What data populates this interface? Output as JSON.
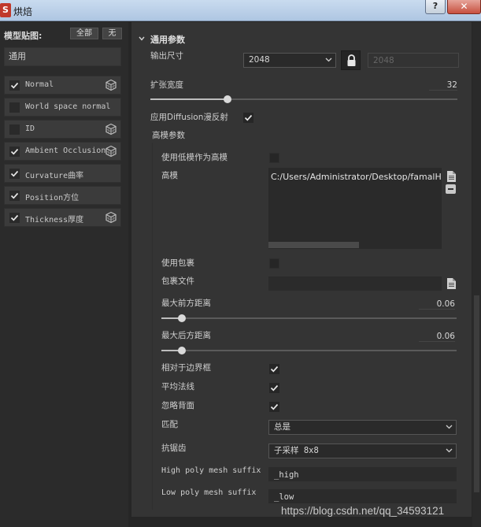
{
  "window": {
    "title": "烘焙",
    "app_icon_letter": "S",
    "help_label": "?",
    "close_label": "✕"
  },
  "left_panel": {
    "header": "模型贴图:",
    "all_label": "全部",
    "none_label": "无",
    "mode_selected": "通用",
    "maps": [
      {
        "label": "Normal",
        "checked": true,
        "has_icon": true
      },
      {
        "label": "World space normal",
        "checked": false,
        "has_icon": false
      },
      {
        "label": "ID",
        "checked": false,
        "has_icon": true
      },
      {
        "label": "Ambient Occlusion",
        "checked": true,
        "has_icon": true
      },
      {
        "label": "Curvature曲率",
        "checked": true,
        "has_icon": false
      },
      {
        "label": "Position方位",
        "checked": true,
        "has_icon": false
      },
      {
        "label": "Thickness厚度",
        "checked": true,
        "has_icon": true
      }
    ]
  },
  "common_params": {
    "section_title": "通用参数",
    "output_size_label": "输出尺寸",
    "output_size_value": "2048",
    "output_size_secondary": "2048",
    "dilation_label": "扩张宽度",
    "dilation_value": "32",
    "dilation_fraction": 0.25,
    "apply_diffusion_label": "应用Diffusion漫反射",
    "apply_diffusion_checked": true,
    "high_poly_section": "高模参数",
    "use_lowpoly_as_high_label": "使用低模作为高模",
    "use_lowpoly_as_high_checked": false,
    "high_poly_label": "高模",
    "high_poly_path": "C:/Users/Administrator/Desktop/famalHe",
    "use_cage_label": "使用包裹",
    "use_cage_checked": false,
    "cage_file_label": "包裹文件",
    "cage_file_value": "",
    "max_front_label": "最大前方距离",
    "max_front_value": "0.06",
    "max_front_fraction": 0.07,
    "max_rear_label": "最大后方距离",
    "max_rear_value": "0.06",
    "max_rear_fraction": 0.07,
    "relative_bbox_label": "相对于边界框",
    "relative_bbox_checked": true,
    "average_normals_label": "平均法线",
    "average_normals_checked": true,
    "ignore_backface_label": "忽略背面",
    "ignore_backface_checked": true,
    "match_label": "匹配",
    "match_value": "总是",
    "antialias_label": "抗锯齿",
    "antialias_value": "子采样 8x8",
    "high_suffix_label": "High poly mesh suffix",
    "high_suffix_value": "_high",
    "low_suffix_label": "Low poly mesh suffix",
    "low_suffix_value": "_low"
  },
  "watermark": "https://blog.csdn.net/qq_34593121"
}
